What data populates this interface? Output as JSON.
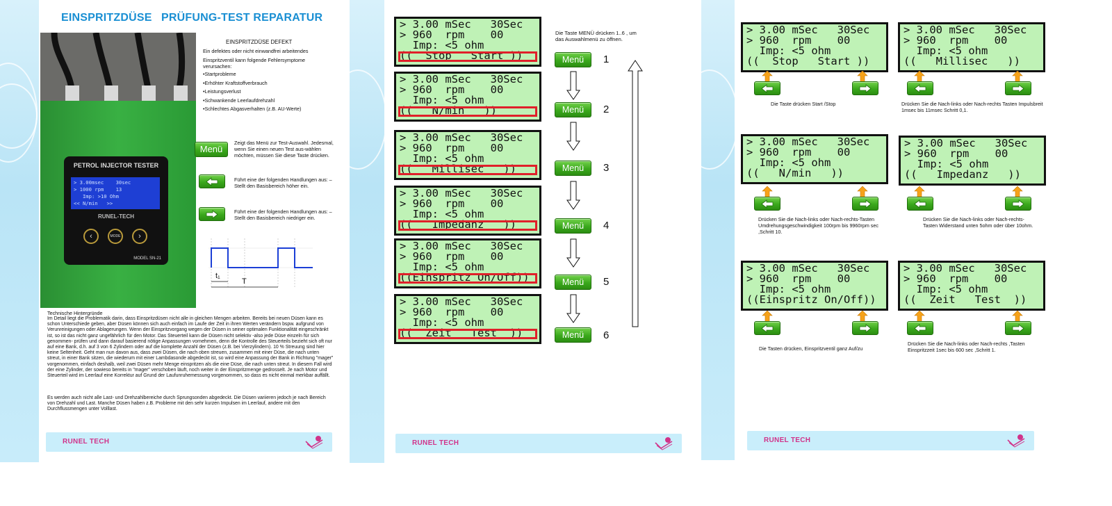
{
  "brand": "RUNEL TECH",
  "page1": {
    "title_left": "EINSPRITZDÜSE",
    "title_right": "PRÜFUNG-TEST REPARATUR",
    "device": {
      "title": "PETROL INJECTOR TESTER",
      "screen": [
        "> 3.00msec    30sec",
        "> 1000 rpm    13",
        "   Imp: >10 Ohm",
        "<< N/min   >>"
      ],
      "brand_plate": "RUNEL-TECH",
      "mode_label": "MODE",
      "model": "MODEL SN-21"
    },
    "defect": {
      "heading": "EINSPRITZDÜSE DEFEKT",
      "intro": "Ein defektes oder nicht einwandfrei arbeitendes",
      "symptoms_intro": "Einspritzventil kann folgende Fehlersymptome verursachen:",
      "items": [
        "•Startprobleme",
        "•Erhöhter Kraftstoffverbrauch",
        "•Leistungsverlust",
        "•Schwankende Leerlaufdrehzahl",
        "•Schlechtes Abgasverhalten (z.B. AU-Werte)"
      ]
    },
    "menu_button": "Menü",
    "menu_desc": "Zeigt das Menü zur Test-Auswahl. Jedesmal, wenn Sie einen neuen Test aus-wählen möchten, müssen Sie diese Taste drücken.",
    "left_desc": "Führt eine der folgenden Handlungen aus: – Stellt den Basisbereich höher  ein.",
    "right_desc": "Führt eine der folgenden Handlungen aus: – Stellt den Basisbereich niedriger ein.",
    "pulse": {
      "t1": "t₁",
      "T": "T"
    },
    "background_heading": "Technische Hintergründe",
    "background_p1": "Im Detail liegt die Problematik darin, dass Einspritzdüsen nicht alle in gleichen Mengen arbeiten. Bereits bei neuen Düsen kann es schon Unterschiede geben, aber Düsen können sich auch einfach im Laufe der Zeit in ihren Werten verändern bspw. aufgrund von Verunreinigungen oder Ablagerungen. Wenn der Einspritzvorgang wegen der Düsen in seiner optimalen Funktionalität eingeschränkt ist, so ist das nicht ganz ungefährlich für den Motor. Das Steuerteil kann die Düsen nicht selektiv  -also jede Düse einzeln für sich genommen- prüfen und dann darauf basierend nötige Anpassungen vornehmen, denn die Kontrolle des Steuerteils bezieht sich oft nur auf eine Bank, d.h. auf 3 von 6 Zylindern oder auf die komplette Anzahl der Düsen (z.B. bei Vierzylindern). 10 % Streuung sind hier keine Seltenheit. Geht man nun davon aus, dass zwei Düsen, die nach oben streuen, zusammen mit einer Düse, die nach unten streut, in einer Bank sitzen, die wiederum mit einer Lambdasonde abgedeckt ist, so wird eine Anpassung der Bank in Richtung \"mager\" vorgenommen, einfach deshalb, weil zwei Düsen mehr Menge einspritzen als die eine Düse, die nach unten streut. In diesem Fall wird der eine Zylinder, der sowieso bereits in \"mager\" verschoben läuft, noch weiter in der Einspritzmenge gedrosselt. Je nach Motor und Steuerteil wird im Leerlauf eine Korrektur auf Grund der Laufunruhemessung vorgenommen, so dass es nicht einmal merkbar auffällt.",
    "background_p2": "Es werden auch nicht alle Last- und Drehzahlbereiche durch Sprungsonden abgedeckt. Die Düsen variieren jedoch je nach Bereich von Drehzahl und Last. Manche Düsen haben z.B. Probleme mit den sehr kurzen Impulsen im Leerlauf, andere mit den Durchflussmengen unter Volllast."
  },
  "page2": {
    "instruction": "Die Taste MENÜ drücken 1..6 , um das Auswahlmenü zu  öffnen.",
    "lcd_line1": "> 3.00 mSec   30Sec",
    "lcd_line2": "> 960  rpm    00",
    "lcd_line3": "  Imp: <5 ohm",
    "menu_button": "Menü",
    "menus": [
      {
        "line4": "((  Stop   Start ))",
        "number": "1"
      },
      {
        "line4": "((   N/min   ))",
        "number": "2"
      },
      {
        "line4": "((   Millisec   ))",
        "number": "3"
      },
      {
        "line4": "((   Impedanz   ))",
        "number": "4"
      },
      {
        "line4": "((Einspritz On/Off))",
        "number": "5"
      },
      {
        "line4": "((  Zeit   Test  ))",
        "number": "6"
      }
    ]
  },
  "page3": {
    "lcd_line1": "> 3.00 mSec   30Sec",
    "lcd_line2": "> 960  rpm    00",
    "lcd_line3": "  Imp: <5 ohm",
    "panels": [
      {
        "line4": "((  Stop   Start ))",
        "caption": "Die Taste drücken Start /Stop"
      },
      {
        "line4": "((   Millisec   ))",
        "caption": "Drücken Sie die Nach-links  oder Nach-rechts Tasten Impulsbreit 1msec  bis 11msec   Schritt 0,1."
      },
      {
        "line4": "((   N/min   ))",
        "caption": "Drücken Sie die Nach-links oder Nach-rechts-Tasten Umdrehungsgeschwindigkeit 100rpm  bis 9960rpm sec ,Schritt 10."
      },
      {
        "line4": "((   Impedanz   ))",
        "caption": "Drücken Sie die Nach-links oder Nach-rechts-Tasten  Widerstand   unten 5ohm oder über 10ohm."
      },
      {
        "line4": "((Einspritz On/Off))",
        "caption": "Die Tasten drücken,  Einspritzventil ganz Auf/zu"
      },
      {
        "line4": "((  Zeit   Test  ))",
        "caption": "Drücken Sie die Nach-links oder Nach-rechts ,Tasten Einspritzzeit 1sec  bis 600 sec ,Schritt 1."
      }
    ]
  },
  "colors": {
    "title_blue": "#1a8fd3",
    "lcd_green": "#bff2b6",
    "highlight_red": "#e0202a",
    "brand_pink": "#d1338a",
    "button_green": "#3aa81c",
    "device_green": "#2fa33a"
  }
}
